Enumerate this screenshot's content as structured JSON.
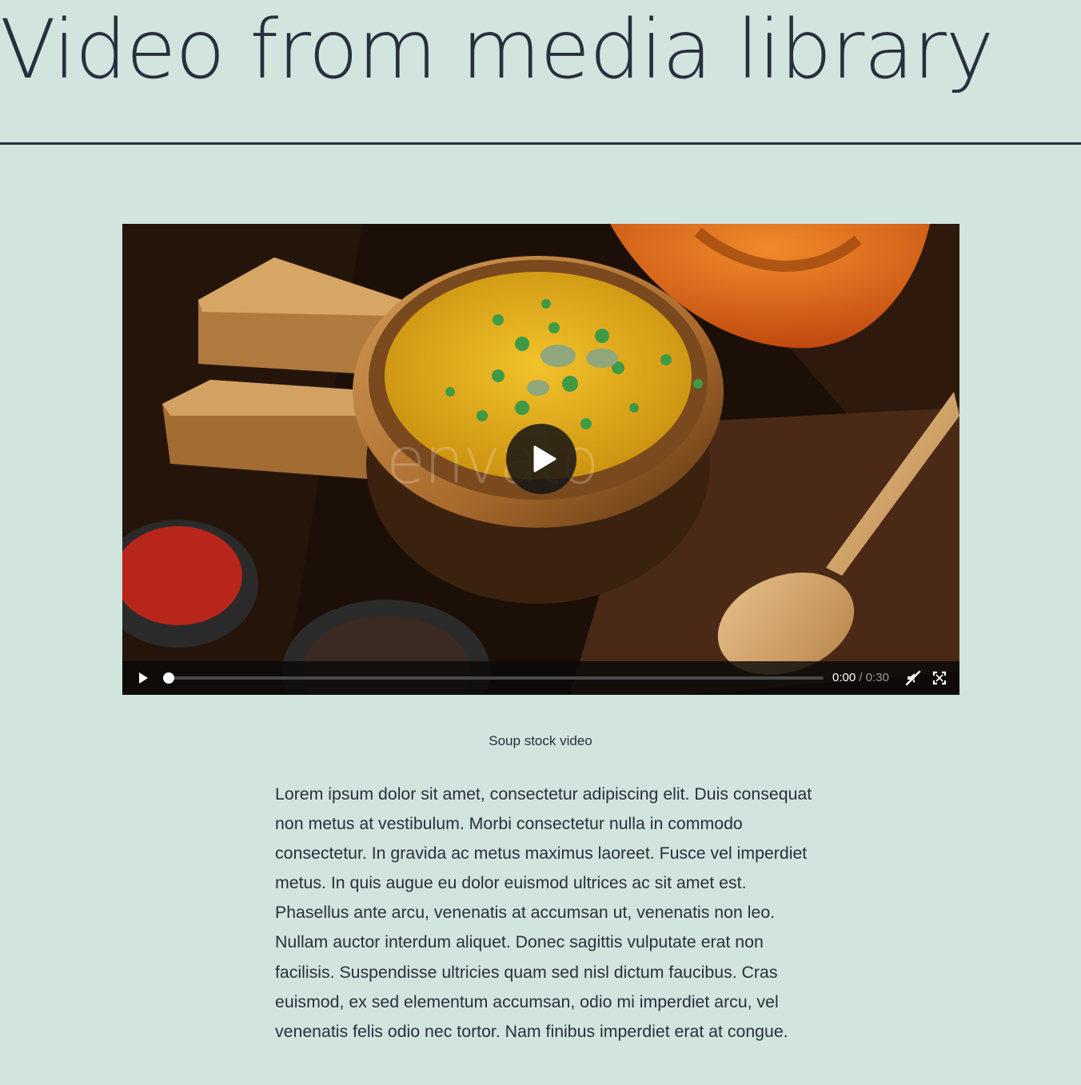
{
  "page": {
    "title": "Video from media library"
  },
  "video": {
    "watermark": "envato",
    "current_time": "0:00",
    "time_separator": " / ",
    "duration": "0:30",
    "progress": 0,
    "caption": "Soup stock video",
    "icons": {
      "big_play": "play-icon",
      "play": "play-icon",
      "volume": "volume-muted-icon",
      "fullscreen": "fullscreen-icon"
    }
  },
  "content": {
    "paragraph": "Lorem ipsum dolor sit amet, consectetur adipiscing elit. Duis consequat non metus at vestibulum. Morbi consectetur nulla in commodo consectetur. In gravida ac metus maximus laoreet. Fusce vel imperdiet metus. In quis augue eu dolor euismod ultrices ac sit amet est. Phasellus ante arcu, venenatis at accumsan ut, venenatis non leo. Nullam auctor interdum aliquet. Donec sagittis vulputate erat non facilisis. Suspendisse ultricies quam sed nisl dictum faucibus. Cras euismod, ex sed elementum accumsan, odio mi imperdiet arcu, vel venenatis felis odio nec tortor. Nam finibus imperdiet erat at congue."
  },
  "colors": {
    "background": "#d1e4dd",
    "text": "#28303d",
    "soup": "#e8b41a",
    "pumpkin": "#e2631b"
  }
}
